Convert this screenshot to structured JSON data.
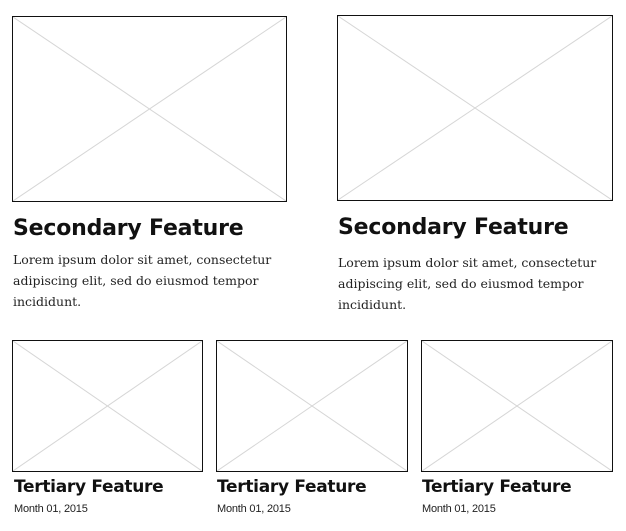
{
  "secondary_features": [
    {
      "title": "Secondary Feature",
      "body_lines": [
        "Lorem ipsum dolor sit amet, consectetur",
        "adipiscing elit, sed do eiusmod tempor",
        "incididunt."
      ]
    },
    {
      "title": "Secondary Feature",
      "body_lines": [
        "Lorem ipsum dolor sit amet, consectetur",
        "adipiscing elit, sed do eiusmod tempor",
        "incididunt."
      ]
    }
  ],
  "tertiary_features": [
    {
      "title": "Tertiary Feature",
      "date": "Month 01, 2015"
    },
    {
      "title": "Tertiary Feature",
      "date": "Month 01, 2015"
    },
    {
      "title": "Tertiary Feature",
      "date": "Month 01, 2015"
    }
  ],
  "colors": {
    "border": "#111111",
    "placeholder_cross": "#d6d6d6"
  },
  "icons": {
    "placeholder": "image-placeholder-icon"
  }
}
